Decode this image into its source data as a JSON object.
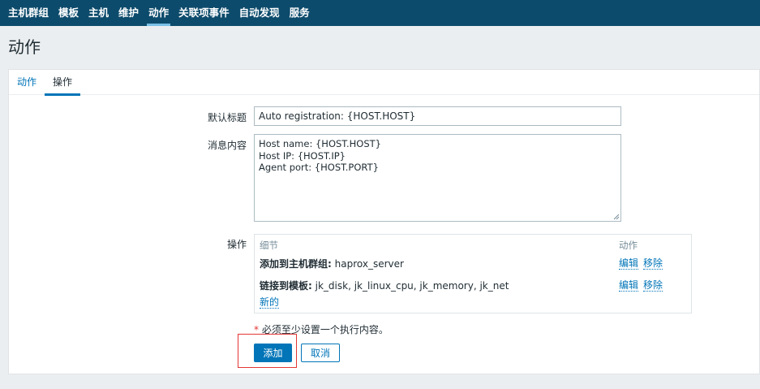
{
  "nav": {
    "items": [
      {
        "label": "主机群组",
        "active": false
      },
      {
        "label": "模板",
        "active": false
      },
      {
        "label": "主机",
        "active": false
      },
      {
        "label": "维护",
        "active": false
      },
      {
        "label": "动作",
        "active": true
      },
      {
        "label": "关联项事件",
        "active": false
      },
      {
        "label": "自动发现",
        "active": false
      },
      {
        "label": "服务",
        "active": false
      }
    ]
  },
  "page": {
    "title": "动作"
  },
  "tabs": [
    {
      "label": "动作",
      "selected": false
    },
    {
      "label": "操作",
      "selected": true
    }
  ],
  "form": {
    "default_subject_label": "默认标题",
    "default_subject_value": "Auto registration: {HOST.HOST}",
    "message_label": "消息内容",
    "message_lines": [
      "Host name: {HOST.HOST}",
      "Host IP: {HOST.IP}",
      "Agent port: {HOST.PORT}"
    ],
    "operations_label": "操作",
    "operations": {
      "header_details": "细节",
      "header_action": "动作",
      "rows": [
        {
          "prefix": "添加到主机群组:",
          "value": "haprox_server",
          "edit": "编辑",
          "remove": "移除"
        },
        {
          "prefix": "链接到模板:",
          "value": "jk_disk, jk_linux_cpu, jk_memory, jk_net",
          "edit": "编辑",
          "remove": "移除"
        }
      ],
      "new_link": "新的"
    },
    "warning_star": "*",
    "warning_text": "必须至少设置一个执行内容。",
    "add_button": "添加",
    "cancel_button": "取消"
  },
  "colors": {
    "nav_bg": "#0d4b6c",
    "accent": "#0275b8",
    "highlight": "#e33734"
  }
}
